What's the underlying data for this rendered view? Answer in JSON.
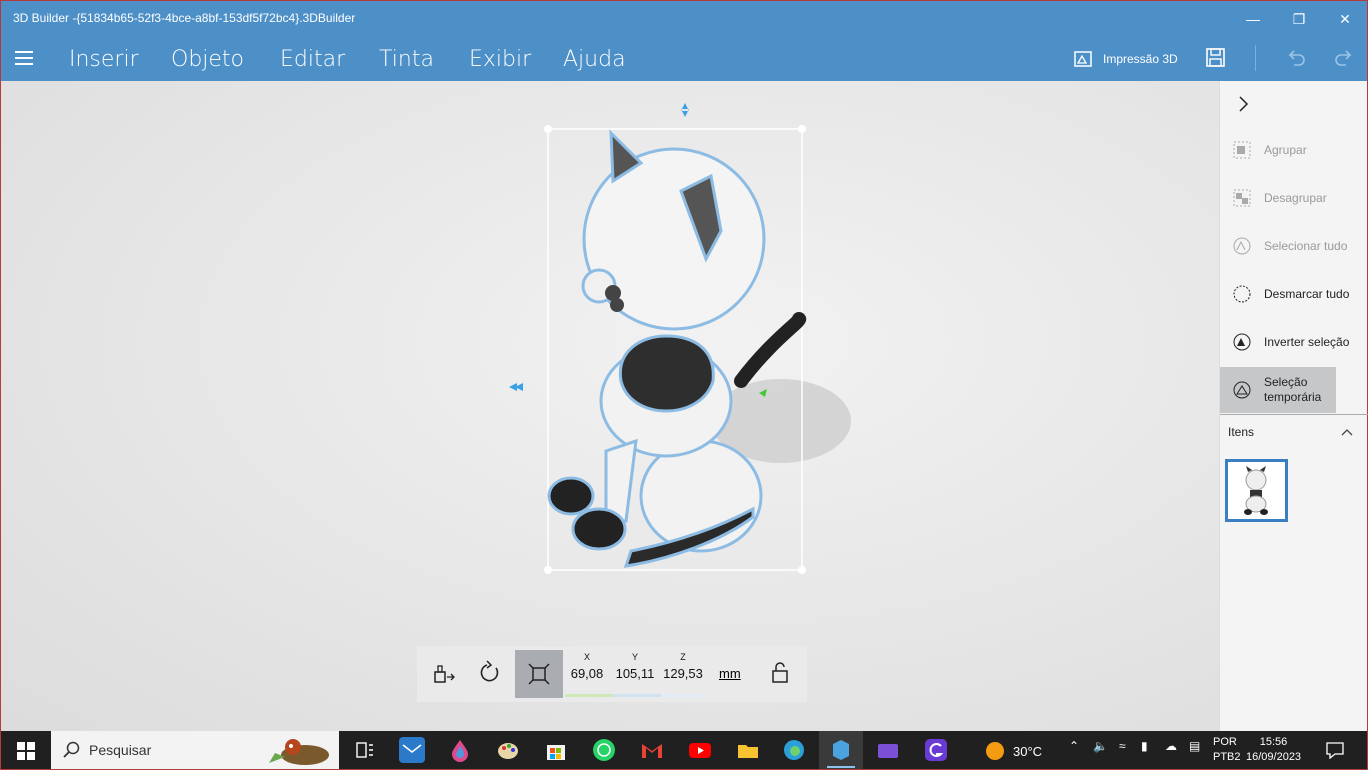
{
  "window": {
    "title": "3D Builder -{51834b65-52f3-4bce-a8bf-153df5f72bc4}.3DBuilder",
    "minimize_icon": "minimize-icon",
    "maximize_icon": "restore-icon",
    "close_icon": "close-icon"
  },
  "menu": {
    "items": [
      "Inserir",
      "Objeto",
      "Editar",
      "Tinta",
      "Exibir",
      "Ajuda"
    ],
    "print_label": "Impressão 3D"
  },
  "panel": {
    "items": [
      {
        "label": "Agrupar",
        "enabled": false
      },
      {
        "label": "Desagrupar",
        "enabled": false
      },
      {
        "label": "Selecionar tudo",
        "enabled": false
      },
      {
        "label": "Desmarcar tudo",
        "enabled": true
      },
      {
        "label": "Inverter seleção",
        "enabled": true
      },
      {
        "label": "Seleção temporária",
        "enabled": true,
        "selected": true
      }
    ],
    "itens_label": "Itens"
  },
  "transform": {
    "x_label": "X",
    "x": "69,08",
    "y_label": "Y",
    "y": "105,11",
    "z_label": "Z",
    "z": "129,53",
    "unit": "mm"
  },
  "taskbar": {
    "search_placeholder": "Pesquisar",
    "weather": "30°C",
    "lang1": "POR",
    "lang2": "PTB2",
    "time": "15:56",
    "date": "16/09/2023"
  },
  "colors": {
    "accent": "#4d90c8",
    "taskbar": "#202020",
    "selection": "#3a7fc1"
  }
}
